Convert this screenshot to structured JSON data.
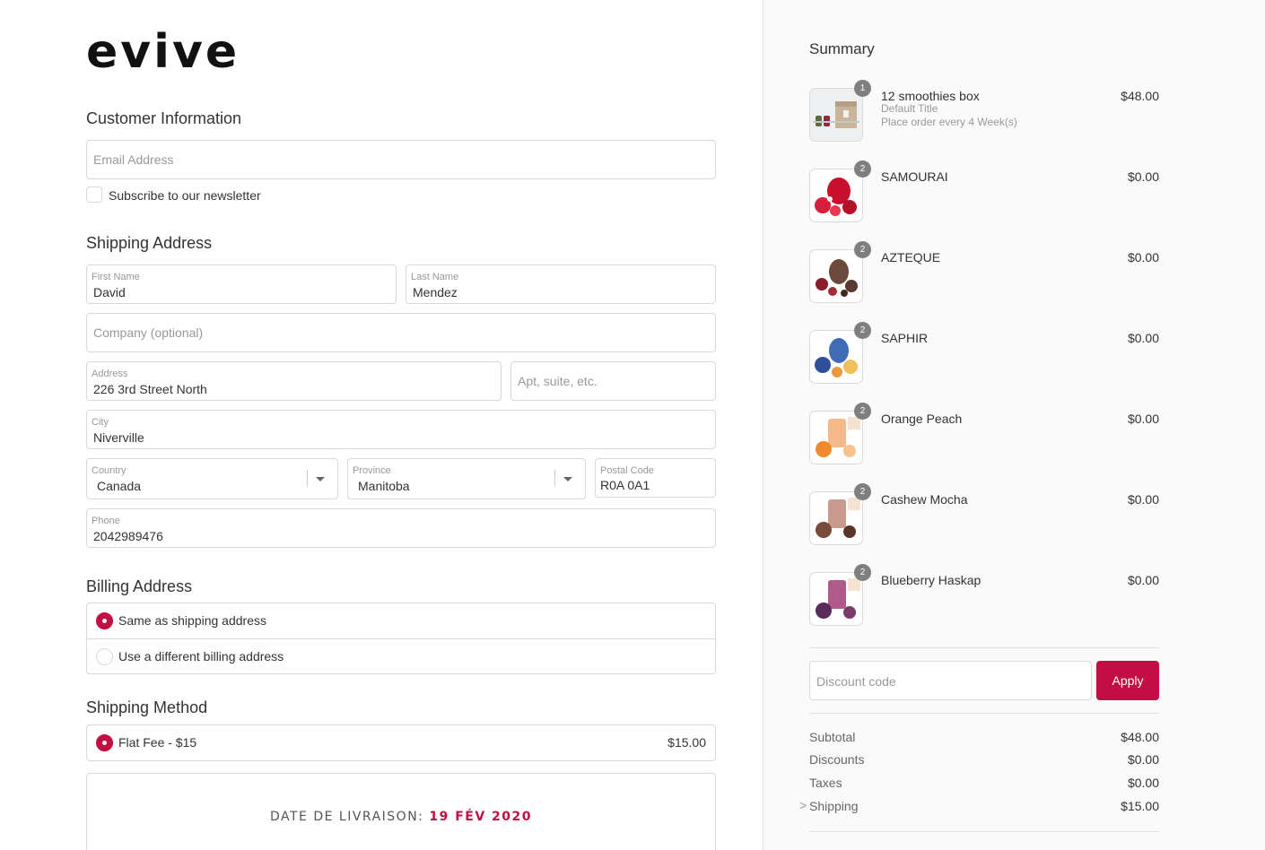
{
  "brand": {
    "logo_text": "evive"
  },
  "customer": {
    "heading": "Customer Information",
    "email_placeholder": "Email Address",
    "newsletter_label": "Subscribe to our newsletter"
  },
  "shipping": {
    "heading": "Shipping Address",
    "first_name": {
      "label": "First Name",
      "value": "David"
    },
    "last_name": {
      "label": "Last Name",
      "value": "Mendez"
    },
    "company_placeholder": "Company (optional)",
    "address": {
      "label": "Address",
      "value": "226 3rd Street North"
    },
    "apt_placeholder": "Apt, suite, etc.",
    "city": {
      "label": "City",
      "value": "Niverville"
    },
    "country": {
      "label": "Country",
      "value": "Canada"
    },
    "province": {
      "label": "Province",
      "value": "Manitoba"
    },
    "postal": {
      "label": "Postal Code",
      "value": "R0A 0A1"
    },
    "phone": {
      "label": "Phone",
      "value": "2042989476"
    }
  },
  "billing": {
    "heading": "Billing Address",
    "options": [
      {
        "label": "Same as shipping address",
        "selected": true
      },
      {
        "label": "Use a different billing address",
        "selected": false
      }
    ]
  },
  "shipping_method": {
    "heading": "Shipping Method",
    "option_label": "Flat Fee - $15",
    "option_price": "$15.00"
  },
  "delivery": {
    "prefix": "DATE DE LIVRAISON: ",
    "date": "19 FÉV 2020"
  },
  "summary": {
    "heading": "Summary",
    "items": [
      {
        "qty": "1",
        "name": "12 smoothies box",
        "variant": "Default Title",
        "note": "Place order every 4 Week(s)",
        "price": "$48.00"
      },
      {
        "qty": "2",
        "name": "SAMOURAI",
        "price": "$0.00"
      },
      {
        "qty": "2",
        "name": "AZTEQUE",
        "price": "$0.00"
      },
      {
        "qty": "2",
        "name": "SAPHIR",
        "price": "$0.00"
      },
      {
        "qty": "2",
        "name": "Orange Peach",
        "price": "$0.00"
      },
      {
        "qty": "2",
        "name": "Cashew Mocha",
        "price": "$0.00"
      },
      {
        "qty": "2",
        "name": "Blueberry Haskap",
        "price": "$0.00"
      }
    ],
    "discount_placeholder": "Discount code",
    "apply_label": "Apply",
    "totals": {
      "subtotal": {
        "label": "Subtotal",
        "value": "$48.00"
      },
      "discounts": {
        "label": "Discounts",
        "value": "$0.00"
      },
      "taxes": {
        "label": "Taxes",
        "value": "$0.00"
      },
      "shipping": {
        "label": "Shipping",
        "value": "$15.00"
      }
    },
    "shipping_chevron": ">"
  },
  "colors": {
    "accent": "#c30e43",
    "border": "#d9d9d9",
    "muted": "#999999"
  }
}
